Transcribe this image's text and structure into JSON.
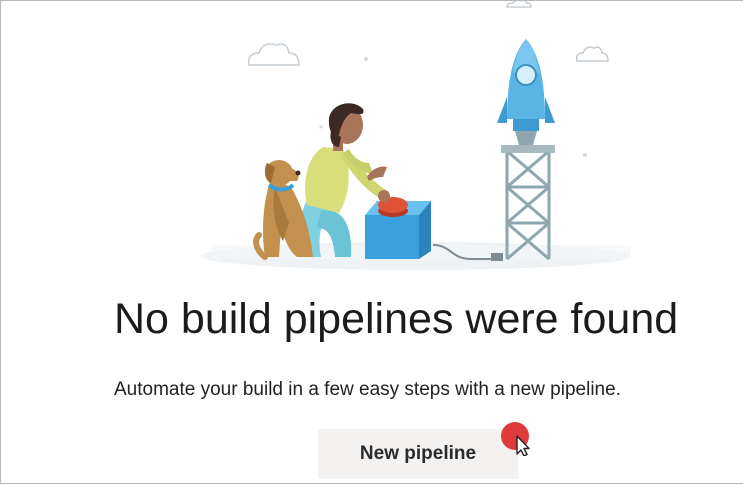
{
  "empty_state": {
    "title": "No build pipelines were found",
    "description": "Automate your build in a few easy steps with a new pipeline.",
    "new_pipeline_label": "New pipeline"
  },
  "illustration": {
    "subject": "person with dog pressing launch button for rocket",
    "colors": {
      "rocket": "#5ab4e5",
      "tower": "#8fa6ad",
      "launch_box": "#3aa0dc",
      "launch_button": "#e0533b",
      "shirt": "#d8df7a",
      "pants": "#7fd0e0",
      "dog": "#c3914d",
      "hair": "#3b2a24"
    }
  },
  "click_marker": {
    "color": "#e03a3a"
  },
  "colors": {
    "button_background": "#f3f2f1",
    "title_text": "#1b1b1b",
    "frame_border": "#b8b8b8"
  }
}
